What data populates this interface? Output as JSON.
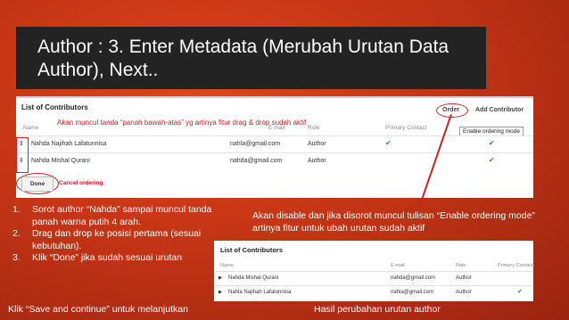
{
  "slide": {
    "title": "Author : 3. Enter Metadata (Merubah Urutan Data Author), Next..",
    "steps": [
      {
        "num": "1.",
        "text": "Sorot author “Nahda” sampai muncul tanda panah warna putih 4 arah."
      },
      {
        "num": "2.",
        "text": "Drag dan drop ke posisi pertama (sesuai kebutuhan)."
      },
      {
        "num": "3.",
        "text": "Klik “Done” jika sudah sesuai urutan"
      }
    ],
    "note_right": "Akan disable dan jika disorot muncul tulisan “Enable ordering mode” artinya fitur untuk ubah urutan sudah aktif",
    "footer_left": "Klik “Save and continue” untuk melanjutkan",
    "footer_right": "Hasil perubahan urutan author"
  },
  "screenshot1": {
    "heading": "List of Contributors",
    "order_label": "Order",
    "add_contributor_label": "Add Contributor",
    "annotation": "Akan muncul tanda “panah bawah-atas” yg artinya fitur drag & drop sudah aktif",
    "tooltip": "Enable ordering mode",
    "columns": {
      "name": "Name",
      "email": "E-mail",
      "role": "Role",
      "primary": "Primary Contact"
    },
    "rows": [
      {
        "name": "Nahda Najihah Lafatunnisa",
        "email": "nahla@gmail.com",
        "role": "Author",
        "primary": true
      },
      {
        "name": "Nahda Mishal Qurani",
        "email": "nahda@gmail.com",
        "role": "Author",
        "primary": false
      }
    ],
    "done_label": "Done",
    "cancel_label": "Cancel ordering"
  },
  "screenshot2": {
    "heading": "List of Contributors",
    "columns": {
      "name": "Name",
      "email": "E-mail",
      "role": "Role",
      "primary": "Primary Contact"
    },
    "rows": [
      {
        "name": "Nahda Mishal Qurani",
        "email": "nahda@gmail.com",
        "role": "Author",
        "primary": false
      },
      {
        "name": "Nahla Najihah Lafatunnisa",
        "email": "nahla@gmail.com",
        "role": "Author",
        "primary": true
      }
    ]
  },
  "icons": {
    "drag_handle": "updown-arrows-icon",
    "expand": "triangle-right-icon",
    "check": "checkmark-icon"
  },
  "colors": {
    "background": "#c43515",
    "title_bar": "#232323",
    "annotation_red": "#d02020",
    "check_green": "#2a9a2a"
  }
}
